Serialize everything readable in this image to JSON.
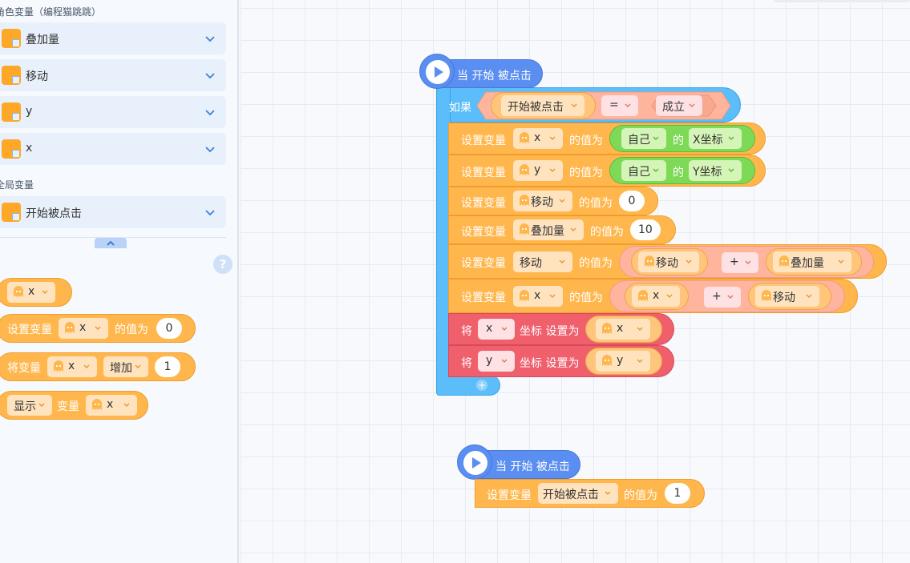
{
  "palette": {
    "role_vars_title": "角色变量（编程猫跳跳）",
    "role_vars": [
      "叠加量",
      "移动",
      "y",
      "x"
    ],
    "global_vars_title": "全局变量",
    "global_vars": [
      "开始被点击"
    ],
    "help": "?"
  },
  "palette_blocks": {
    "var_reporter": "x",
    "set_var": {
      "label": "设置变量",
      "var": "x",
      "value_label": "的值为",
      "value": "0"
    },
    "change_var": {
      "label": "将变量",
      "var": "x",
      "op": "增加",
      "value": "1"
    },
    "show_var": {
      "mode": "显示",
      "label": "变量",
      "var": "x"
    }
  },
  "script1": {
    "hat": "当 开始 被点击",
    "if_label": "如果",
    "cond_left": "开始被点击",
    "cond_op": "=",
    "cond_right": "成立",
    "set_label": "设置变量",
    "value_label": "的值为",
    "of_label": "的",
    "self": "自己",
    "x": "x",
    "y": "y",
    "x_coord": "X坐标",
    "y_coord": "Y坐标",
    "move": "移动",
    "stack": "叠加量",
    "val0": "0",
    "val10": "10",
    "plus": "+",
    "jiang": "将",
    "coord_set": "坐标 设置为"
  },
  "script2": {
    "hat": "当 开始 被点击",
    "set_label": "设置变量",
    "var": "开始被点击",
    "value_label": "的值为",
    "value": "1"
  }
}
